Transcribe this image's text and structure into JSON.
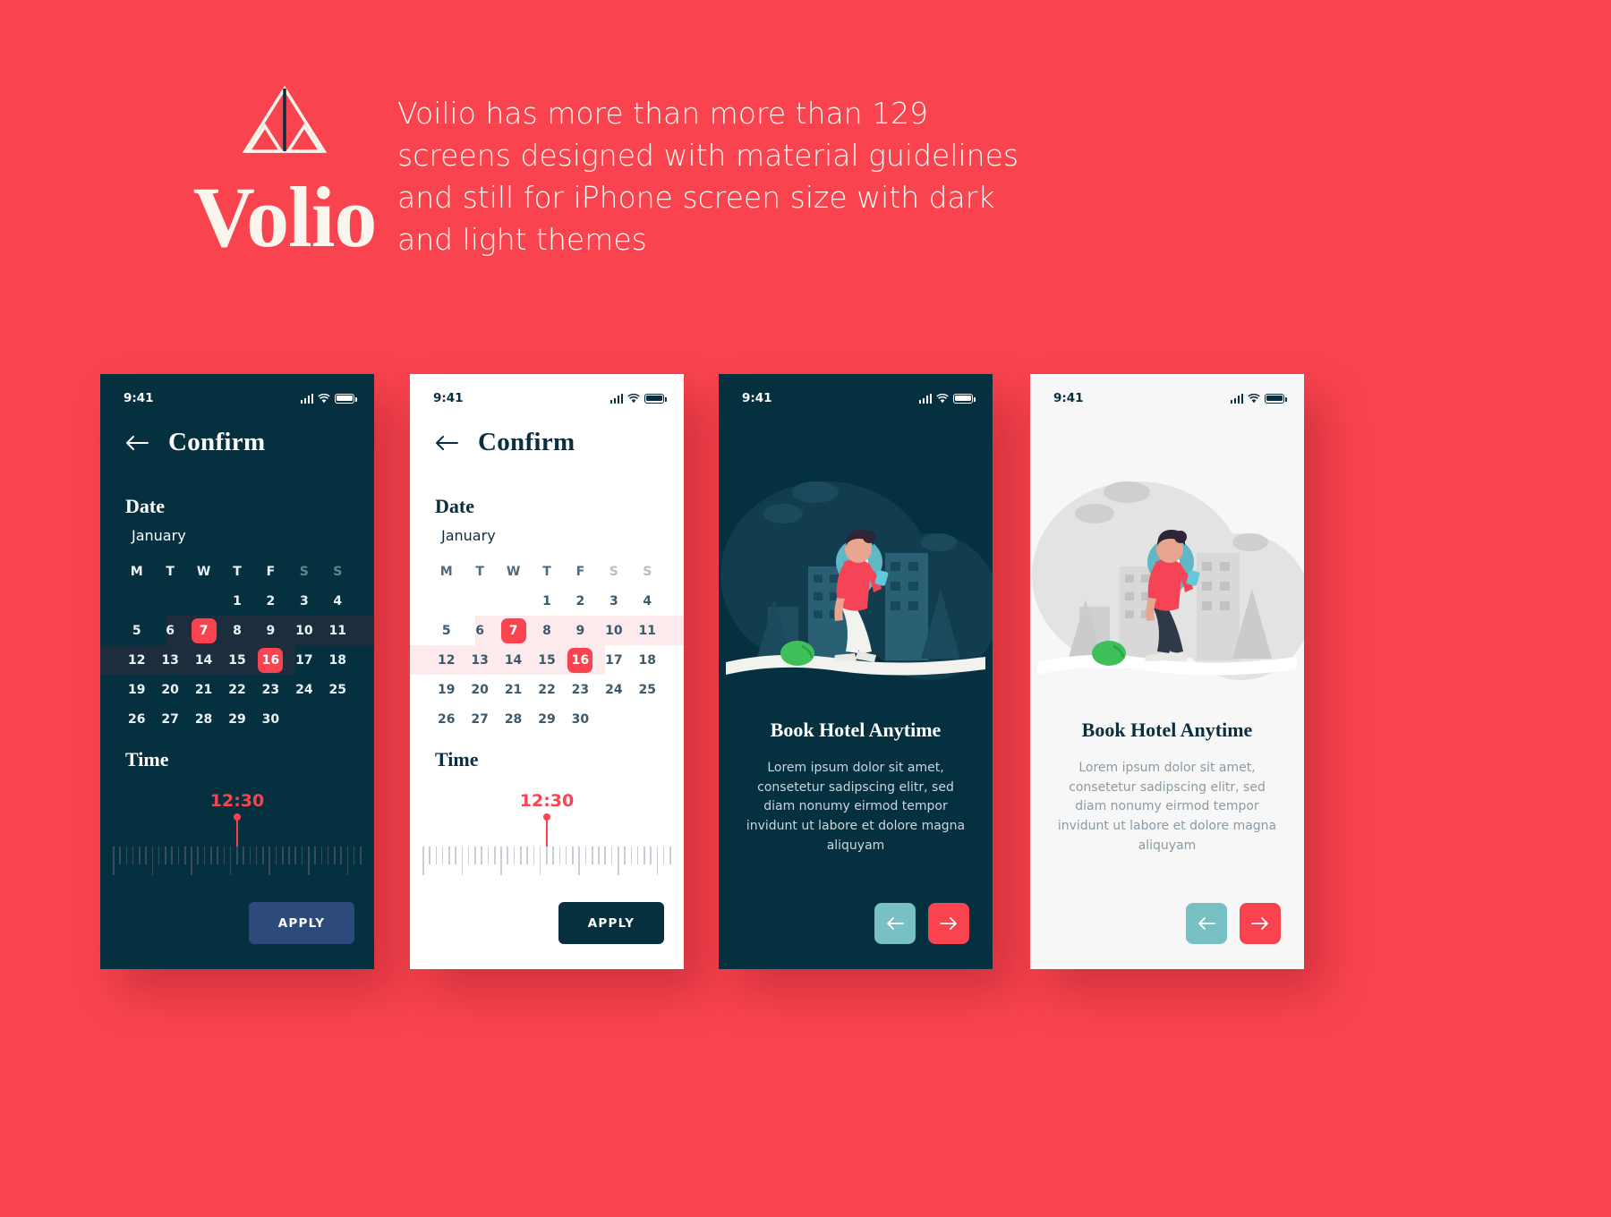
{
  "brand": {
    "name": "Volio",
    "logo_icon": "mountain-logo-icon",
    "tagline": "Voilio has more than more than 129 screens designed with material guidelines and still for iPhone screen size with dark and light themes",
    "accent_color": "#F9444F",
    "dark_color": "#05303F",
    "teal_color": "#79C0C4"
  },
  "status_bar": {
    "time": "9:41",
    "signal_icon": "signal-bars-icon",
    "wifi_icon": "wifi-icon",
    "battery_icon": "battery-icon"
  },
  "confirm_screen": {
    "back_icon": "back-arrow-icon",
    "title": "Confirm",
    "date_label": "Date",
    "month": "January",
    "weekdays": [
      "M",
      "T",
      "W",
      "T",
      "F",
      "S",
      "S"
    ],
    "weeks": [
      [
        "",
        "",
        "",
        "1",
        "2",
        "3",
        "4"
      ],
      [
        "5",
        "6",
        "7",
        "8",
        "9",
        "10",
        "11"
      ],
      [
        "12",
        "13",
        "14",
        "15",
        "16",
        "17",
        "18"
      ],
      [
        "19",
        "20",
        "21",
        "22",
        "23",
        "24",
        "25"
      ],
      [
        "26",
        "27",
        "28",
        "29",
        "30",
        "",
        ""
      ]
    ],
    "selected_start": "7",
    "selected_end": "16",
    "time_label": "Time",
    "time_value": "12:30",
    "apply_label": "APPLY"
  },
  "onboarding": {
    "illustration_icon": "person-walking-with-map-pin-illustration",
    "title": "Book Hotel Anytime",
    "body": "Lorem ipsum dolor sit amet, consetetur sadipscing elitr, sed diam nonumy eirmod tempor invidunt ut labore et dolore magna aliquyam",
    "prev_icon": "arrow-left-icon",
    "next_icon": "arrow-right-icon"
  }
}
